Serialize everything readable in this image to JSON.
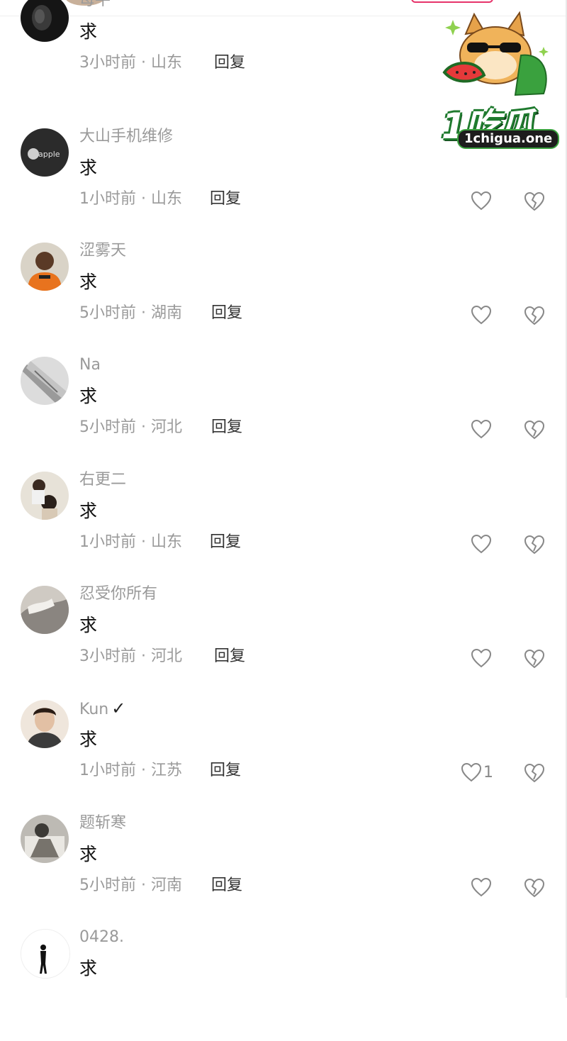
{
  "colors": {
    "username": "#9a9a9a",
    "content": "#111111",
    "meta": "#9a9a9a",
    "reply": "#333333",
    "icon": "#888888",
    "accent": "#e6336a",
    "logo_green": "#3aa13e"
  },
  "watermark": {
    "title": "1吃瓜",
    "url": "1chigua.one"
  },
  "reply_label": "回复",
  "comments": [
    {
      "username": "母牛",
      "content": "求",
      "meta": "3小时前 · 山东",
      "reply": "回复",
      "avatar": "dark-face-avatar",
      "likes": null,
      "show_actions": false
    },
    {
      "username": "大山手机维修",
      "content": "求",
      "meta": "1小时前 · 山东",
      "reply": "回复",
      "avatar": "apple-logo-avatar",
      "avatar_text": "apple",
      "likes": null,
      "show_actions": true
    },
    {
      "username": "涩雾天",
      "content": "求",
      "meta": "5小时前 · 湖南",
      "reply": "回复",
      "avatar": "orange-jersey-avatar",
      "likes": null,
      "show_actions": true
    },
    {
      "username": "Na",
      "content": "求",
      "meta": "5小时前 · 河北",
      "reply": "回复",
      "avatar": "grey-jacket-avatar",
      "likes": null,
      "show_actions": true
    },
    {
      "username": "右更二",
      "content": "求",
      "meta": "1小时前 · 山东",
      "reply": "回复",
      "avatar": "couple-photo-avatar",
      "likes": null,
      "show_actions": true
    },
    {
      "username": "忍受你所有",
      "content": "求",
      "meta": "3小时前 · 河北",
      "reply": "回复",
      "avatar": "fabric-avatar",
      "likes": null,
      "show_actions": true
    },
    {
      "username": "Kun",
      "verified": "✓",
      "content": "求",
      "meta": "1小时前 · 江苏",
      "reply": "回复",
      "avatar": "portrait-avatar",
      "likes": "1",
      "show_actions": true
    },
    {
      "username": "题斩寒",
      "content": "求",
      "meta": "5小时前 · 河南",
      "reply": "回复",
      "avatar": "monochrome-avatar",
      "likes": null,
      "show_actions": true
    },
    {
      "username": "0428.",
      "content": "求",
      "meta": "",
      "reply": "",
      "avatar": "silhouette-avatar",
      "likes": null,
      "show_actions": false
    }
  ]
}
